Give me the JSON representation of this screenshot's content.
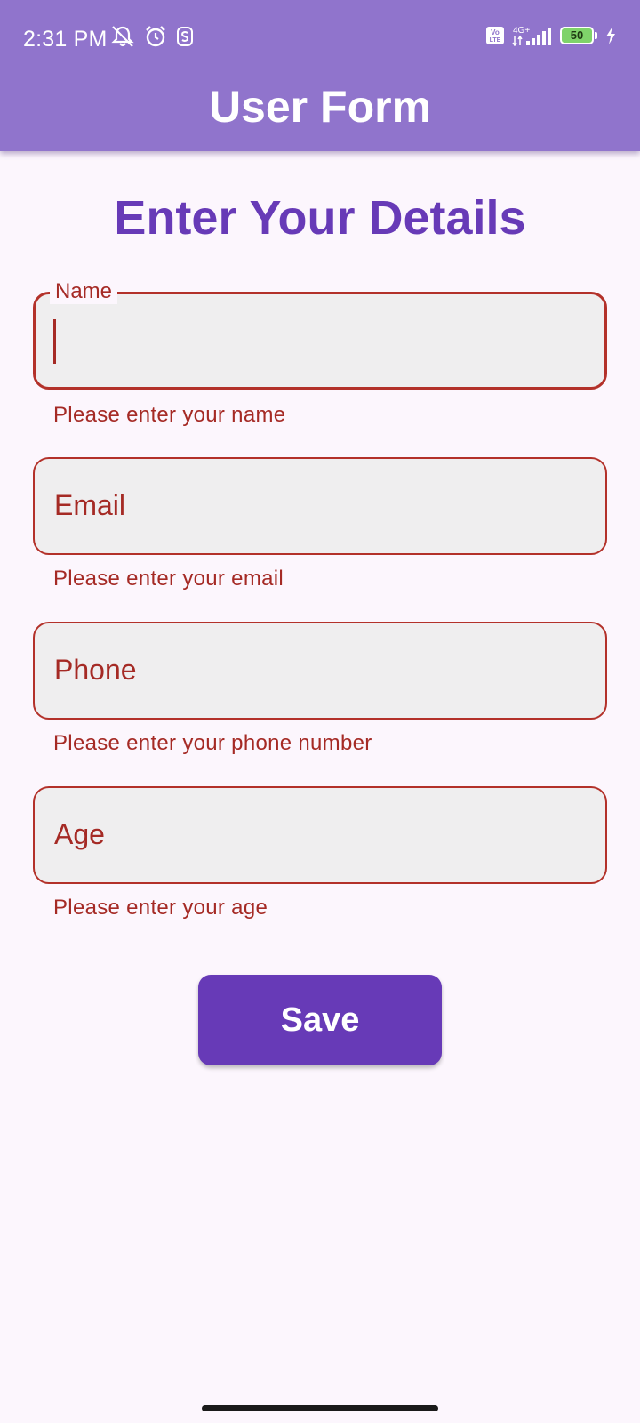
{
  "status_bar": {
    "time": "2:31 PM",
    "left_icons": [
      "notification-off-icon",
      "alarm-icon",
      "app-s-icon"
    ],
    "network_label": "4G+",
    "volte_label": "Vo LTE",
    "battery_level": "50"
  },
  "app_bar": {
    "title": "User Form",
    "background_color": "#9074cc"
  },
  "form": {
    "heading": "Enter Your Details",
    "accent_color": "#673ab7",
    "error_color": "#a52a25",
    "fields": [
      {
        "label": "Name",
        "value": "",
        "error": "Please enter your name",
        "focused": true
      },
      {
        "label": "Email",
        "value": "",
        "error": "Please enter your email",
        "focused": false
      },
      {
        "label": "Phone",
        "value": "",
        "error": "Please enter your phone number",
        "focused": false
      },
      {
        "label": "Age",
        "value": "",
        "error": "Please enter your age",
        "focused": false
      }
    ],
    "save_label": "Save"
  }
}
